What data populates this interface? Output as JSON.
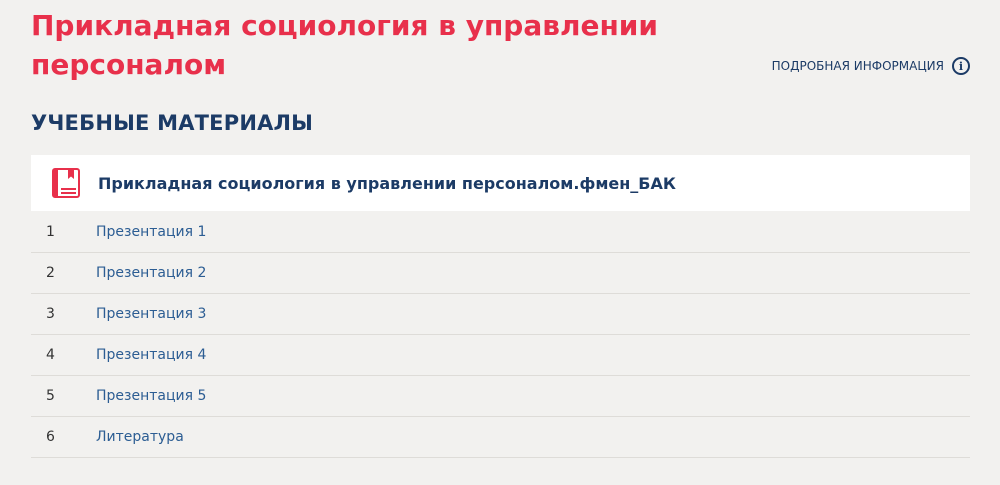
{
  "header": {
    "title": "Прикладная социология в управлении персоналом",
    "info_link": "ПОДРОБНАЯ ИНФОРМАЦИЯ",
    "info_icon_glyph": "i"
  },
  "section": {
    "title": "УЧЕБНЫЕ МАТЕРИАЛЫ"
  },
  "course": {
    "title": "Прикладная социология в управлении персоналом.фмен_БАК",
    "icon": "book-icon"
  },
  "materials": [
    {
      "num": "1",
      "label": "Презентация 1"
    },
    {
      "num": "2",
      "label": "Презентация 2"
    },
    {
      "num": "3",
      "label": "Презентация 3"
    },
    {
      "num": "4",
      "label": "Презентация 4"
    },
    {
      "num": "5",
      "label": "Презентация 5"
    },
    {
      "num": "6",
      "label": "Литература"
    }
  ],
  "colors": {
    "title_red": "#e8304b",
    "navy": "#1c3b66",
    "link_blue": "#2c5d93",
    "background": "#f2f1ef"
  }
}
